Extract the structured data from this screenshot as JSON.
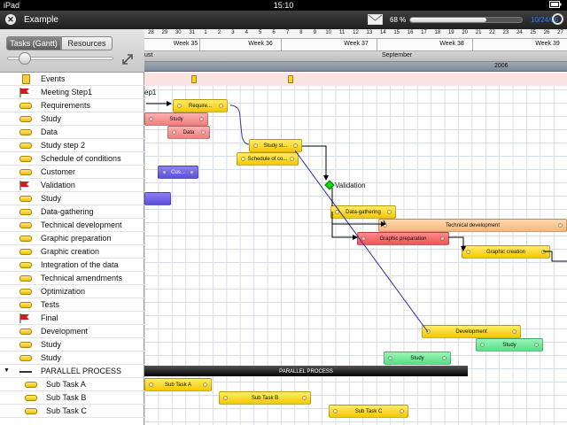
{
  "status": {
    "device": "iPad",
    "time": "15:10"
  },
  "titlebar": {
    "title": "Example",
    "close_icon": "close-circle-icon",
    "mail_icon": "envelope-icon",
    "percent": "68 %",
    "progress": 0.68,
    "date": "10/24/06",
    "sync_icon": "sync-icon"
  },
  "left": {
    "tabs": [
      {
        "label": "Tasks (Gantt)",
        "active": true
      },
      {
        "label": "Resources",
        "active": false
      }
    ],
    "zoom_slider": 0.12,
    "rows": [
      {
        "label": "Events",
        "icon": "event"
      },
      {
        "label": "Meeting Step1",
        "icon": "flag"
      },
      {
        "label": "Requirements",
        "icon": "task"
      },
      {
        "label": "Study",
        "icon": "task"
      },
      {
        "label": "Data",
        "icon": "task"
      },
      {
        "label": "Study step 2",
        "icon": "task"
      },
      {
        "label": "Schedule of conditions",
        "icon": "task"
      },
      {
        "label": "Customer",
        "icon": "task"
      },
      {
        "label": "Validation",
        "icon": "flag"
      },
      {
        "label": "Study",
        "icon": "task"
      },
      {
        "label": "Data-gathering",
        "icon": "task"
      },
      {
        "label": "Technical development",
        "icon": "task"
      },
      {
        "label": "Graphic preparation",
        "icon": "task"
      },
      {
        "label": "Graphic creation",
        "icon": "task"
      },
      {
        "label": "Integration of the data",
        "icon": "task"
      },
      {
        "label": "Technical amendments",
        "icon": "task"
      },
      {
        "label": "Optimization",
        "icon": "task"
      },
      {
        "label": "Tests",
        "icon": "task"
      },
      {
        "label": "Final",
        "icon": "flag"
      },
      {
        "label": "Development",
        "icon": "task"
      },
      {
        "label": "Study",
        "icon": "task"
      },
      {
        "label": "Study",
        "icon": "task"
      },
      {
        "label": "PARALLEL PROCESS",
        "icon": "line",
        "group": true
      },
      {
        "label": "Sub Task A",
        "icon": "task",
        "sub": true
      },
      {
        "label": "Sub Task B",
        "icon": "task",
        "sub": true
      },
      {
        "label": "Sub Task C",
        "icon": "task",
        "sub": true
      }
    ]
  },
  "timeline": {
    "days": [
      "28",
      "29",
      "30",
      "31",
      "1",
      "2",
      "3",
      "4",
      "5",
      "6",
      "7",
      "8",
      "9",
      "10",
      "11",
      "12",
      "13",
      "14",
      "15",
      "16",
      "17",
      "18",
      "19",
      "20",
      "21",
      "22",
      "23",
      "24",
      "25",
      "26",
      "27"
    ],
    "weeks": [
      "Week 35",
      "Week 36",
      "Week 37",
      "Week 38",
      "Week 39"
    ],
    "months": [
      "ust",
      "September"
    ],
    "year": "2006",
    "fragment_label": "ep1",
    "milestone_label": "Validation"
  },
  "bars": [
    {
      "name": "Require...",
      "row": 2,
      "color": "y"
    },
    {
      "name": "Study",
      "row": 3,
      "color": "p"
    },
    {
      "name": "Data",
      "row": 4,
      "color": "p"
    },
    {
      "name": "Study st...",
      "row": 5,
      "color": "y"
    },
    {
      "name": "Schedule of co...",
      "row": 6,
      "color": "y"
    },
    {
      "name": "Cus...",
      "row": 7,
      "color": "b"
    },
    {
      "name": "",
      "row": 9,
      "color": "b"
    },
    {
      "name": "Data-gathering",
      "row": 10,
      "color": "y"
    },
    {
      "name": "Technical development",
      "row": 11,
      "color": "o"
    },
    {
      "name": "Graphic preparation",
      "row": 12,
      "color": "r"
    },
    {
      "name": "Graphic creation",
      "row": 13,
      "color": "y"
    },
    {
      "name": "Development",
      "row": 19,
      "color": "y"
    },
    {
      "name": "Study",
      "row": 20,
      "color": "g"
    },
    {
      "name": "Study",
      "row": 21,
      "color": "g"
    },
    {
      "name": "PARALLEL PROCESS",
      "row": 22,
      "color": "k"
    },
    {
      "name": "Sub Task A",
      "row": 23,
      "color": "y"
    },
    {
      "name": "Sub Task B",
      "row": 24,
      "color": "y"
    },
    {
      "name": "Sub Task C",
      "row": 25,
      "color": "y"
    }
  ]
}
